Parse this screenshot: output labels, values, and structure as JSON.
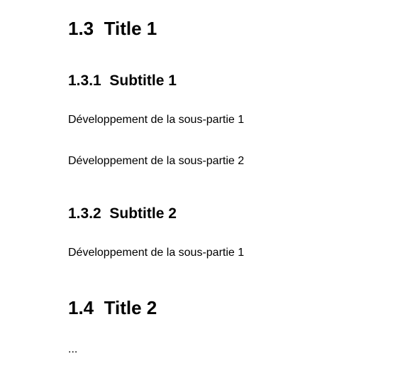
{
  "sections": [
    {
      "number": "1.3",
      "title": "Title 1",
      "subsections": [
        {
          "number": "1.3.1",
          "title": "Subtitle 1",
          "paragraphs": [
            "Développement de la sous-partie 1",
            "Développement de la sous-partie 2"
          ]
        },
        {
          "number": "1.3.2",
          "title": "Subtitle 2",
          "paragraphs": [
            "Développement de la sous-partie 1"
          ]
        }
      ]
    },
    {
      "number": "1.4",
      "title": "Title 2",
      "body": "..."
    }
  ]
}
